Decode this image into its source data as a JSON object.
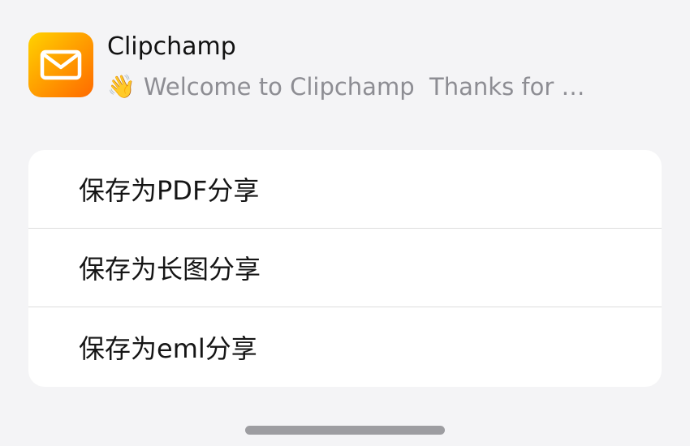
{
  "notification": {
    "app_icon": "mail-envelope-icon",
    "title": "Clipchamp",
    "preview_emoji": "👋",
    "preview_text": "Welcome to Clipchamp  Thanks for …"
  },
  "share_menu": {
    "items": [
      {
        "label": "保存为PDF分享"
      },
      {
        "label": "保存为长图分享"
      },
      {
        "label": "保存为eml分享"
      }
    ]
  },
  "colors": {
    "icon_gradient_start": "#ffd200",
    "icon_gradient_end": "#ff6a00",
    "sheet_background": "#f4f4f6",
    "menu_background": "#ffffff"
  }
}
